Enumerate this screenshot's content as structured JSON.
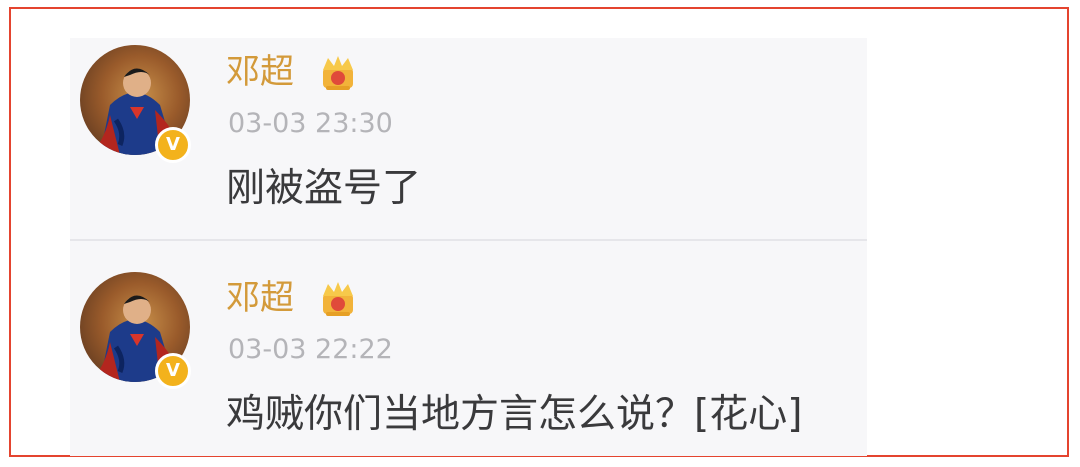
{
  "posts": [
    {
      "username": "邓超",
      "timestamp": "03-03 23:30",
      "content": "刚被盗号了",
      "avatar_icon": "superman-avatar",
      "verified_icon": "verified-v-badge",
      "member_icon": "crown-vip-icon",
      "verified_label": "V"
    },
    {
      "username": "邓超",
      "timestamp": "03-03 22:22",
      "content": "鸡贼你们当地方言怎么说？[花心]",
      "avatar_icon": "superman-avatar",
      "verified_icon": "verified-v-badge",
      "member_icon": "crown-vip-icon",
      "verified_label": "V"
    }
  ],
  "colors": {
    "username": "#d39a3a",
    "timestamp": "#b4b4b8",
    "content": "#3a3a3c",
    "verified_badge": "#f3b21c",
    "frame_border": "#e4442f",
    "panel_background": "#f7f7f9"
  }
}
